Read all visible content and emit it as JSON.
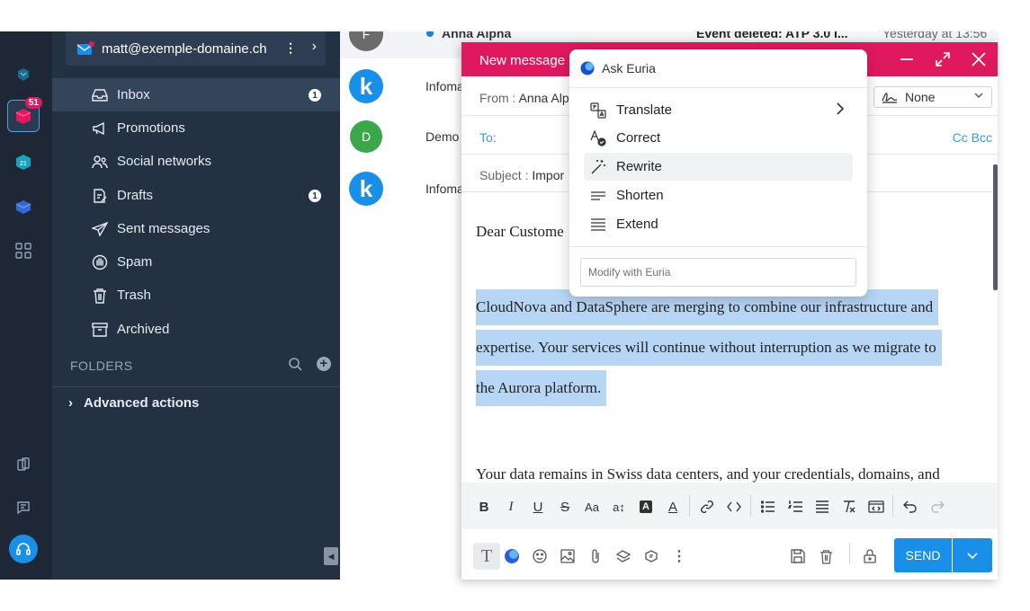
{
  "rail": {
    "mail_badge": "51"
  },
  "account": {
    "email": "matt@exemple-domaine.ch"
  },
  "folders": {
    "items": [
      {
        "label": "Inbox",
        "count": "1"
      },
      {
        "label": "Promotions"
      },
      {
        "label": "Social networks"
      },
      {
        "label": "Drafts",
        "count": "1"
      },
      {
        "label": "Sent messages"
      },
      {
        "label": "Spam"
      },
      {
        "label": "Trash"
      },
      {
        "label": "Archived"
      }
    ],
    "section_title": "FOLDERS",
    "advanced_actions": "Advanced actions"
  },
  "maillist": {
    "rows": [
      {
        "avatar": "F",
        "sender": "Anna Alpha",
        "subject": "Event deleted: ATP 3.0 I...",
        "date": "Yesterday at 13:56"
      },
      {
        "avatar": "k",
        "sender": "Infoma"
      },
      {
        "avatar": "D",
        "sender": "Demo"
      },
      {
        "avatar": "k",
        "sender": "Infoma"
      }
    ]
  },
  "compose": {
    "title": "New message",
    "from_label": "From :",
    "from_value": "Anna Alp",
    "signature_value": "None",
    "to_label": "To:",
    "cc_bcc": "Cc Bcc",
    "subject_label": "Subject :",
    "subject_value": "Impor",
    "body": {
      "greeting": "Dear Custome",
      "selected_lines": [
        "CloudNova and DataSphere are merging to combine our infrastructure and",
        "expertise. Your services will continue without interruption as we migrate to",
        "the Aurora platform."
      ],
      "para2": "Your data remains in Swiss data centers, and your credentials, domains, and"
    },
    "send_label": "SEND"
  },
  "euria": {
    "title": "Ask Euria",
    "items": [
      {
        "label": "Translate"
      },
      {
        "label": "Correct"
      },
      {
        "label": "Rewrite"
      },
      {
        "label": "Shorten"
      },
      {
        "label": "Extend"
      }
    ],
    "input_placeholder": "Modify with Euria"
  },
  "colors": {
    "compose_header": "#e0195e",
    "send": "#1a8fe8",
    "sidebar": "#243143",
    "rail": "#1e2735",
    "selection": "#b7d5f5"
  }
}
